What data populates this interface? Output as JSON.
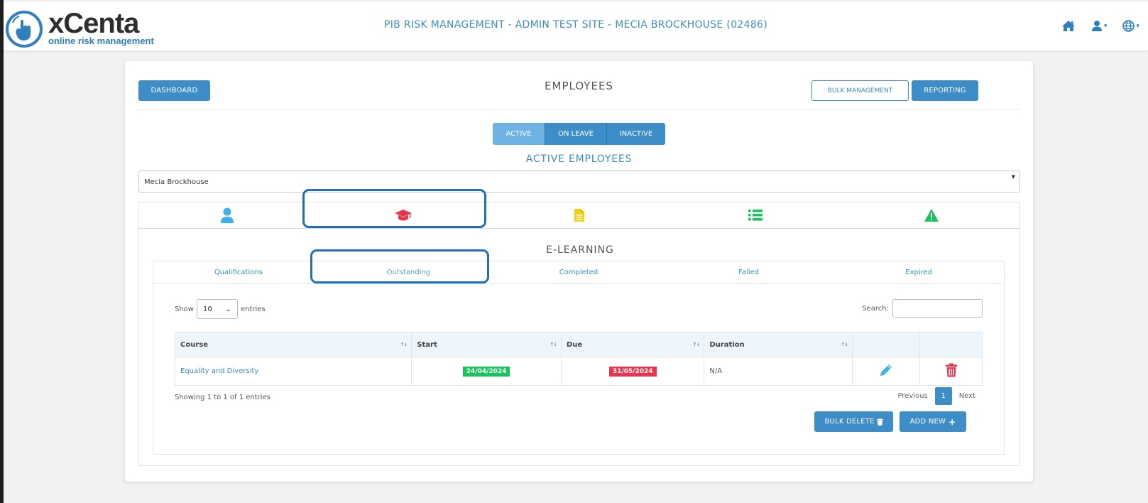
{
  "header": {
    "logo_main": "xCenta",
    "logo_sub": "online risk management",
    "site_title": "PIB RISK MANAGEMENT - ADMIN TEST SITE - MECIA BROCKHOUSE (02486)",
    "icons": [
      "home-icon",
      "user-icon",
      "globe-icon"
    ]
  },
  "page": {
    "dashboard_label": "DASHBOARD",
    "title": "EMPLOYEES",
    "bulk_management_label": "BULK MANAGEMENT",
    "reporting_label": "REPORTING",
    "status_tabs": [
      {
        "label": "ACTIVE",
        "active": true
      },
      {
        "label": "ON LEAVE",
        "active": false
      },
      {
        "label": "INACTIVE",
        "active": false
      }
    ],
    "subtitle": "ACTIVE EMPLOYEES",
    "employee_select": "Mecia Brockhouse"
  },
  "icon_tabs": [
    {
      "icon": "user-icon",
      "color": "#3bb3e8"
    },
    {
      "icon": "graduation-cap-icon",
      "color": "#e8354d",
      "active": true
    },
    {
      "icon": "document-icon",
      "color": "#f3d20f"
    },
    {
      "icon": "list-icon",
      "color": "#16c45b"
    },
    {
      "icon": "warning-icon",
      "color": "#16c45b"
    }
  ],
  "elearning": {
    "heading": "E-LEARNING",
    "tabs": [
      {
        "label": "Qualifications",
        "active": false
      },
      {
        "label": "Outstanding",
        "active": true
      },
      {
        "label": "Completed",
        "active": false
      },
      {
        "label": "Failed",
        "active": false
      },
      {
        "label": "Expired",
        "active": false
      }
    ],
    "show_label": "Show",
    "entries_value": "10",
    "entries_label": "entries",
    "search_label": "Search:",
    "columns": [
      "Course",
      "Start",
      "Due",
      "Duration"
    ],
    "rows": [
      {
        "course": "Equality and Diversity",
        "start": "24/04/2024",
        "due": "31/05/2024",
        "duration": "N/A"
      }
    ],
    "showing": "Showing 1 to 1 of 1 entries",
    "previous": "Previous",
    "page": "1",
    "next": "Next",
    "bulk_delete_label": "BULK DELETE",
    "add_new_label": "ADD NEW"
  },
  "colors": {
    "primary": "#3c8dc8",
    "start_badge": "#16c45b",
    "due_badge": "#e8354d",
    "highlight": "#1f6fba"
  }
}
